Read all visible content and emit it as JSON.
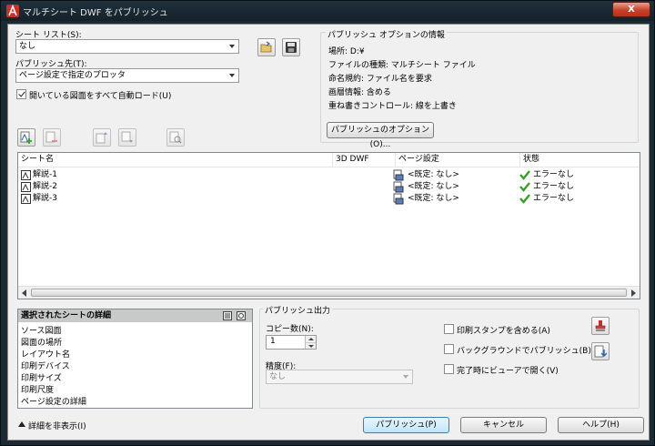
{
  "window": {
    "title": "マルチシート DWF をパブリッシュ",
    "close_label": "X"
  },
  "sheet_list": {
    "label": "シート リスト(S):",
    "value": "なし"
  },
  "publish_to": {
    "label": "パブリッシュ先(T):",
    "value": "ページ設定で指定のプロッタ"
  },
  "autoload": {
    "label": "開いている図面をすべて自動ロード(U)",
    "checked": true
  },
  "options_info": {
    "title": "パブリッシュ オプションの情報",
    "lines": [
      "場所: D:¥",
      "ファイルの種類: マルチシート ファイル",
      "命名規約: ファイル名を要求",
      "画層情報: 含める",
      "重ね書きコントロール: 線を上書き"
    ],
    "button": "パブリッシュのオプション(O)..."
  },
  "columns": [
    "シート名",
    "3D DWF",
    "ページ設定",
    "状態"
  ],
  "sheets": [
    {
      "name": "解説-1",
      "page_setup": "<既定: なし>",
      "status": "エラーなし"
    },
    {
      "name": "解説-2",
      "page_setup": "<既定: なし>",
      "status": "エラーなし"
    },
    {
      "name": "解説-3",
      "page_setup": "<既定: なし>",
      "status": "エラーなし"
    }
  ],
  "details": {
    "title": "選択されたシートの詳細",
    "items": [
      "ソース図面",
      "図面の場所",
      "レイアウト名",
      "印刷デバイス",
      "印刷サイズ",
      "印刷尺度",
      "ページ設定の詳細"
    ]
  },
  "publish_output": {
    "title": "パブリッシュ出力",
    "copies_label": "コピー数(N):",
    "copies_value": "1",
    "precision_label": "精度(F):",
    "precision_value": "なし",
    "stamp": {
      "label": "印刷スタンプを含める(A)",
      "checked": false
    },
    "background": {
      "label": "バックグラウンドでパブリッシュ(B)",
      "checked": false
    },
    "viewer": {
      "label": "完了時にビューアで開く(V)",
      "checked": false
    }
  },
  "footer": {
    "hide_details": "詳細を非表示(I)",
    "publish": "パブリッシュ(P)",
    "cancel": "キャンセル",
    "help": "ヘルプ(H)"
  },
  "icons": {
    "app": "autocad-logo-icon",
    "check": "green-check-icon"
  },
  "colors": {
    "title_bar": "#1b2a33",
    "close": "#c7412a",
    "check": "#3a9d2e",
    "panel_header": "#c9c9c9"
  }
}
